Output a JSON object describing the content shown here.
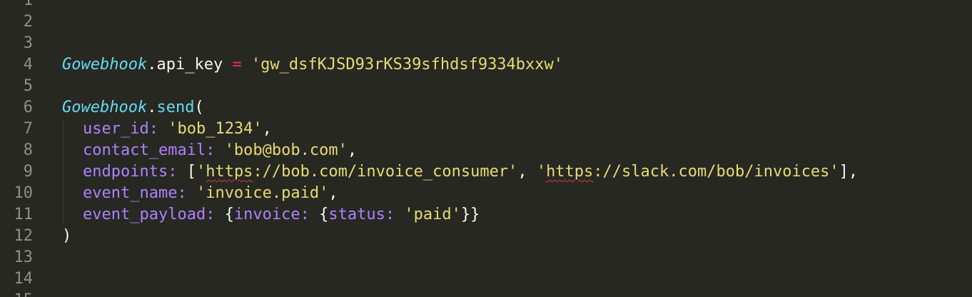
{
  "line_numbers": [
    "1",
    "2",
    "3",
    "4",
    "5",
    "6",
    "7",
    "8",
    "9",
    "10",
    "11",
    "12",
    "13",
    "14",
    "15"
  ],
  "code": {
    "l4": {
      "obj": "Gowebhook",
      "dot": ".",
      "attr": "api_key",
      "sp1": " ",
      "eq": "=",
      "sp2": " ",
      "val": "'gw_dsfKJSD93rKS39sfhdsf9334bxxw'"
    },
    "l6": {
      "obj": "Gowebhook",
      "dot": ".",
      "method": "send",
      "paren": "("
    },
    "l7": {
      "key": "user_id:",
      "sp": " ",
      "val": "'bob_1234'",
      "comma": ","
    },
    "l8": {
      "key": "contact_email:",
      "sp": " ",
      "val": "'bob@bob.com'",
      "comma": ","
    },
    "l9": {
      "key": "endpoints:",
      "sp": " ",
      "bracket_open": "[",
      "url1_quote": "'",
      "url1_word": "https",
      "url1_rest": "://bob.com/invoice_consumer'",
      "sep": ", ",
      "url2_quote": "'",
      "url2_word": "https",
      "url2_rest": "://slack.com/bob/invoices'",
      "bracket_close": "]",
      "comma": ","
    },
    "l10": {
      "key": "event_name:",
      "sp": " ",
      "val": "'invoice.paid'",
      "comma": ","
    },
    "l11": {
      "key": "event_payload:",
      "sp1": " ",
      "brace1": "{",
      "key2": "invoice:",
      "sp2": " ",
      "brace2": "{",
      "key3": "status:",
      "sp3": " ",
      "val": "'paid'",
      "close": "}}"
    },
    "l12": {
      "paren": ")"
    }
  },
  "colors": {
    "background": "#272822",
    "gutter_text": "#8f908a",
    "class": "#66d9ef",
    "operator": "#f92672",
    "string": "#e6db74",
    "symbol": "#ae81ff",
    "plain": "#f8f8f2",
    "spellcheck": "#e0383e"
  }
}
